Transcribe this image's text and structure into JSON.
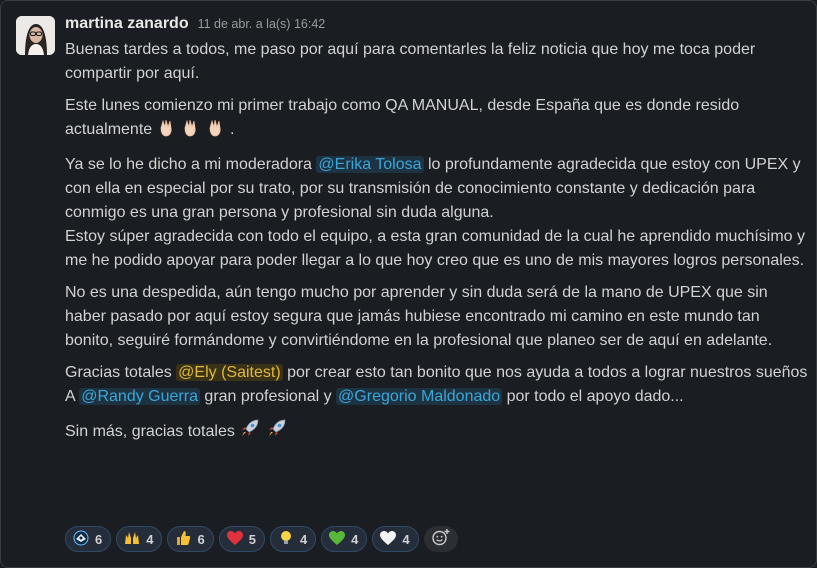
{
  "message": {
    "author": "martina zanardo",
    "timestamp": "11 de abr. a la(s) 16:42",
    "p1": "Buenas tardes a todos, me paso por aquí para comentarles la feliz noticia que hoy me toca poder compartir por aquí.",
    "p2": "Este lunes comienzo mi primer trabajo como QA MANUAL, desde España que es donde resido actualmente",
    "p2_end": " .",
    "p3a": "Ya se lo he dicho a mi moderadora ",
    "mention_erika": "@Erika Tolosa",
    "p3b": " lo profundamente agradecida que estoy con UPEX y con ella en especial por su trato, por su transmisión de conocimiento constante y dedicación para conmigo es una gran persona y profesional sin duda alguna.",
    "p3c": "Estoy súper agradecida con todo el equipo, a esta gran comunidad de la cual he aprendido muchísimo y me he podido apoyar para poder llegar a lo que hoy creo que es uno de mis mayores logros personales.",
    "p4": "No es una despedida, aún tengo mucho por aprender y sin duda será de la mano de UPEX que sin haber pasado por aquí estoy segura que jamás hubiese encontrado mi camino en este mundo tan bonito, seguiré formándome y convirtiéndome en la profesional que planeo ser de aquí en adelante.",
    "p5a": "Gracias totales ",
    "mention_ely": "@Ely (Saitest)",
    "p5b": " por crear esto tan bonito que nos ayuda a todos a lograr nuestros sueños",
    "p5c": "A ",
    "mention_randy": "@Randy Guerra",
    "p5d": " gran profesional y ",
    "mention_gregorio": "@Gregorio Maldonado",
    "p5e": " por todo el apoyo dado...",
    "p6": "Sin más, gracias totales"
  },
  "reactions": [
    {
      "icon": "custom-team-icon",
      "count": "6"
    },
    {
      "icon": "raised-hands-icon",
      "count": "4"
    },
    {
      "icon": "thumbs-up-icon",
      "count": "6"
    },
    {
      "icon": "red-heart-icon",
      "count": "5"
    },
    {
      "icon": "light-bulb-icon",
      "count": "4"
    },
    {
      "icon": "green-heart-icon",
      "count": "4"
    },
    {
      "icon": "white-heart-icon",
      "count": "4"
    }
  ],
  "colors": {
    "background": "#1a1d21",
    "mention_text": "#3ba6d9",
    "mention_bg": "#1d3341",
    "self_mention_text": "#e0b83e",
    "reaction_border": "#2f4a66"
  }
}
